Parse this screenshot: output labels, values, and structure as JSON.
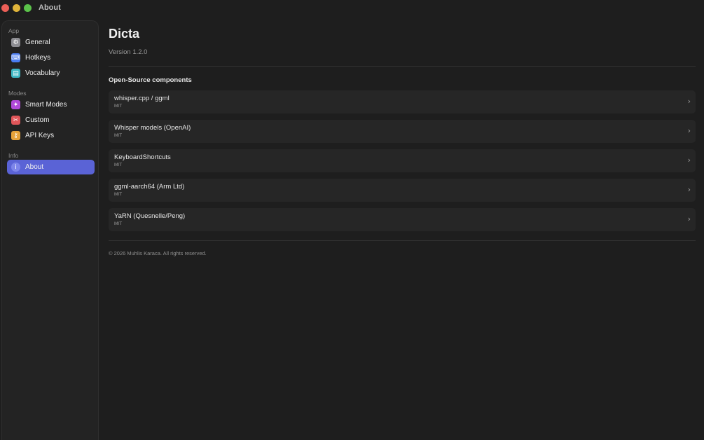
{
  "window": {
    "title": "About"
  },
  "sidebar": {
    "sections": [
      {
        "label": "App",
        "items": [
          {
            "label": "General",
            "icon": "gear-icon",
            "color": "#8e8e93"
          },
          {
            "label": "Hotkeys",
            "icon": "keyboard-icon",
            "color": "#4a7cf0"
          },
          {
            "label": "Vocabulary",
            "icon": "book-icon",
            "color": "#3fb7c4"
          }
        ]
      },
      {
        "label": "Modes",
        "items": [
          {
            "label": "Smart Modes",
            "icon": "sparkles-icon",
            "color": "#b14ad9"
          },
          {
            "label": "Custom",
            "icon": "tools-icon",
            "color": "#e0565a"
          },
          {
            "label": "API Keys",
            "icon": "key-icon",
            "color": "#e6a23a"
          }
        ]
      },
      {
        "label": "Info",
        "items": [
          {
            "label": "About",
            "icon": "info-icon",
            "color": "#5a63d6",
            "active": true
          }
        ]
      }
    ]
  },
  "about": {
    "app_name": "Dicta",
    "version": "Version 1.2.0",
    "components_title": "Open-Source components",
    "components": [
      {
        "name": "whisper.cpp / ggml",
        "license": "MIT"
      },
      {
        "name": "Whisper models (OpenAI)",
        "license": "MIT"
      },
      {
        "name": "KeyboardShortcuts",
        "license": "MIT"
      },
      {
        "name": "ggml-aarch64 (Arm Ltd)",
        "license": "MIT"
      },
      {
        "name": "YaRN (Quesnelle/Peng)",
        "license": "MIT"
      }
    ],
    "copyright": "© 2026 Muhlis Karaca. All rights reserved."
  }
}
